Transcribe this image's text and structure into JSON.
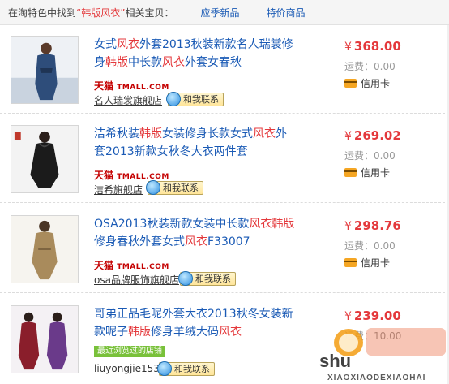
{
  "header": {
    "prefix_before": "在淘特色中找到",
    "keyword": "“韩版风衣”",
    "prefix_after": "相关宝贝：",
    "tabs": [
      "应季新品",
      "特价商品"
    ]
  },
  "items": [
    {
      "title_parts": [
        {
          "t": "女式",
          "hl": false
        },
        {
          "t": "风衣",
          "hl": true
        },
        {
          "t": "外套2013秋装新款名人瑞裳修身",
          "hl": false
        },
        {
          "t": "韩版",
          "hl": true
        },
        {
          "t": "中长款",
          "hl": false
        },
        {
          "t": "风衣",
          "hl": true
        },
        {
          "t": "外套女春秋",
          "hl": false
        }
      ],
      "store_cn": "天猫",
      "store_en": "TMALL.COM",
      "shop": "名人瑞裳旗舰店",
      "contact": "和我联系",
      "currency": "¥",
      "price": "368.00",
      "ship_label": "运费：",
      "ship": "0.00",
      "payment": "信用卡"
    },
    {
      "title_parts": [
        {
          "t": "洁希秋装",
          "hl": false
        },
        {
          "t": "韩版",
          "hl": true
        },
        {
          "t": "女装修身长款女式",
          "hl": false
        },
        {
          "t": "风衣",
          "hl": true
        },
        {
          "t": "外套2013新款女秋冬大衣两件套",
          "hl": false
        }
      ],
      "store_cn": "天猫",
      "store_en": "TMALL.COM",
      "shop": "洁希旗舰店",
      "contact": "和我联系",
      "currency": "¥",
      "price": "269.02",
      "ship_label": "运费：",
      "ship": "0.00",
      "payment": "信用卡"
    },
    {
      "title_parts": [
        {
          "t": "OSA2013秋装新款女装中长款",
          "hl": false
        },
        {
          "t": "风衣",
          "hl": true
        },
        {
          "t": "韩版",
          "hl": true
        },
        {
          "t": "修身春秋外套女式",
          "hl": false
        },
        {
          "t": "风衣",
          "hl": true
        },
        {
          "t": "F33007",
          "hl": false
        }
      ],
      "store_cn": "天猫",
      "store_en": "TMALL.COM",
      "shop": "osa品牌服饰旗舰店",
      "contact": "和我联系",
      "currency": "¥",
      "price": "298.76",
      "ship_label": "运费：",
      "ship": "0.00",
      "payment": "信用卡"
    },
    {
      "title_parts": [
        {
          "t": "哥弟正品毛呢外套大衣2013秋冬女装新款呢子",
          "hl": false
        },
        {
          "t": "韩版",
          "hl": true
        },
        {
          "t": "修身羊绒大码",
          "hl": false
        },
        {
          "t": "风衣",
          "hl": true
        }
      ],
      "recent_badge": "最近浏览过的店铺",
      "shop": "liuyongjie153",
      "contact": "和我联系",
      "currency": "¥",
      "price": "239.00",
      "ship_label": "运费：",
      "ship": "10.00"
    }
  ],
  "watermark": {
    "line1": "shu",
    "line2": "XIAOXIAODEXIAOHAI"
  },
  "colors": {
    "link": "#1a5ab5",
    "highlight": "#e4393c",
    "price": "#e4393c",
    "tmall": "#c40000",
    "recent_badge": "#79c13a"
  }
}
